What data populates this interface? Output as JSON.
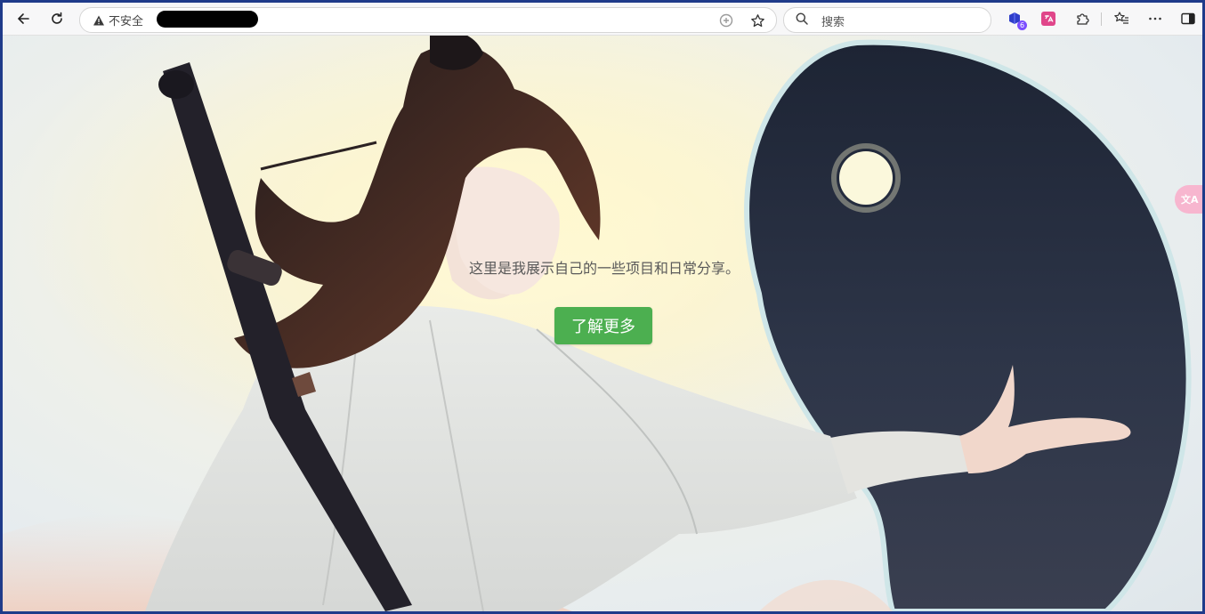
{
  "browser": {
    "security_label": "不安全",
    "search_placeholder": "搜索",
    "extension_badge": "6",
    "icons": {
      "back": "arrow-left-icon",
      "reload": "reload-icon",
      "warning": "warning-triangle-icon",
      "reader": "read-aloud-icon",
      "favorite": "star-icon",
      "search": "search-icon",
      "extensions": "puzzle-icon",
      "favorites": "favorites-list-icon",
      "more": "more-dots-icon",
      "sidebar": "sidebar-icon"
    }
  },
  "hero": {
    "description": "这里是我展示自己的一些项目和日常分享。",
    "button_label": "了解更多",
    "button_color": "#4caf50"
  },
  "floating": {
    "translate_icon": "translate-icon"
  }
}
